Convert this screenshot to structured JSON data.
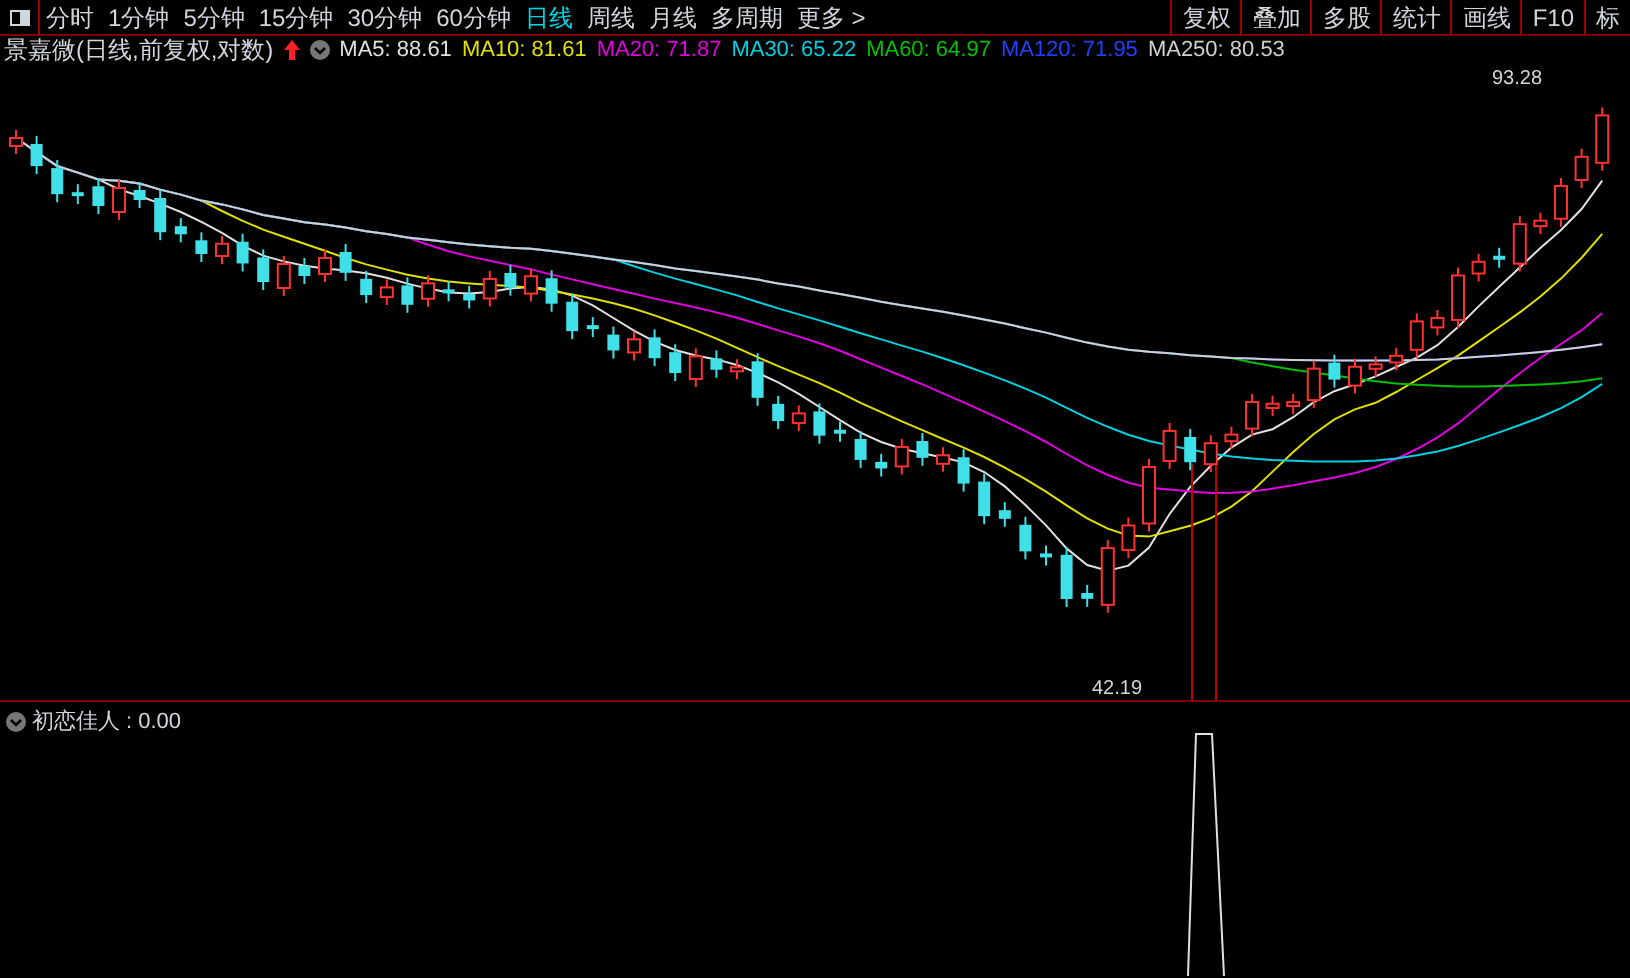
{
  "toolbar": {
    "periods": [
      {
        "label": "分时",
        "selected": false
      },
      {
        "label": "1分钟",
        "selected": false
      },
      {
        "label": "5分钟",
        "selected": false
      },
      {
        "label": "15分钟",
        "selected": false
      },
      {
        "label": "30分钟",
        "selected": false
      },
      {
        "label": "60分钟",
        "selected": false
      },
      {
        "label": "日线",
        "selected": true
      },
      {
        "label": "周线",
        "selected": false
      },
      {
        "label": "月线",
        "selected": false
      },
      {
        "label": "多周期",
        "selected": false
      },
      {
        "label": "更多 >",
        "selected": false
      }
    ],
    "buttons": [
      "复权",
      "叠加",
      "多股",
      "统计",
      "画线",
      "F10",
      "标"
    ]
  },
  "legend": {
    "title": "景嘉微(日线,前复权,对数)",
    "items": [
      {
        "label": "MA5: 88.61",
        "color": "#e0e0e0"
      },
      {
        "label": "MA10: 81.61",
        "color": "#e0e000"
      },
      {
        "label": "MA20: 71.87",
        "color": "#e000e0"
      },
      {
        "label": "MA30: 65.22",
        "color": "#00d0e0"
      },
      {
        "label": "MA60: 64.97",
        "color": "#00c000"
      },
      {
        "label": "MA120: 71.95",
        "color": "#2040ff"
      },
      {
        "label": "MA250: 80.53",
        "color": "#d0d0d0"
      }
    ]
  },
  "price_labels": {
    "high": "93.28",
    "low": "42.19"
  },
  "indicator": {
    "name": "初恋佳人",
    "value": ": 0.00"
  }
}
